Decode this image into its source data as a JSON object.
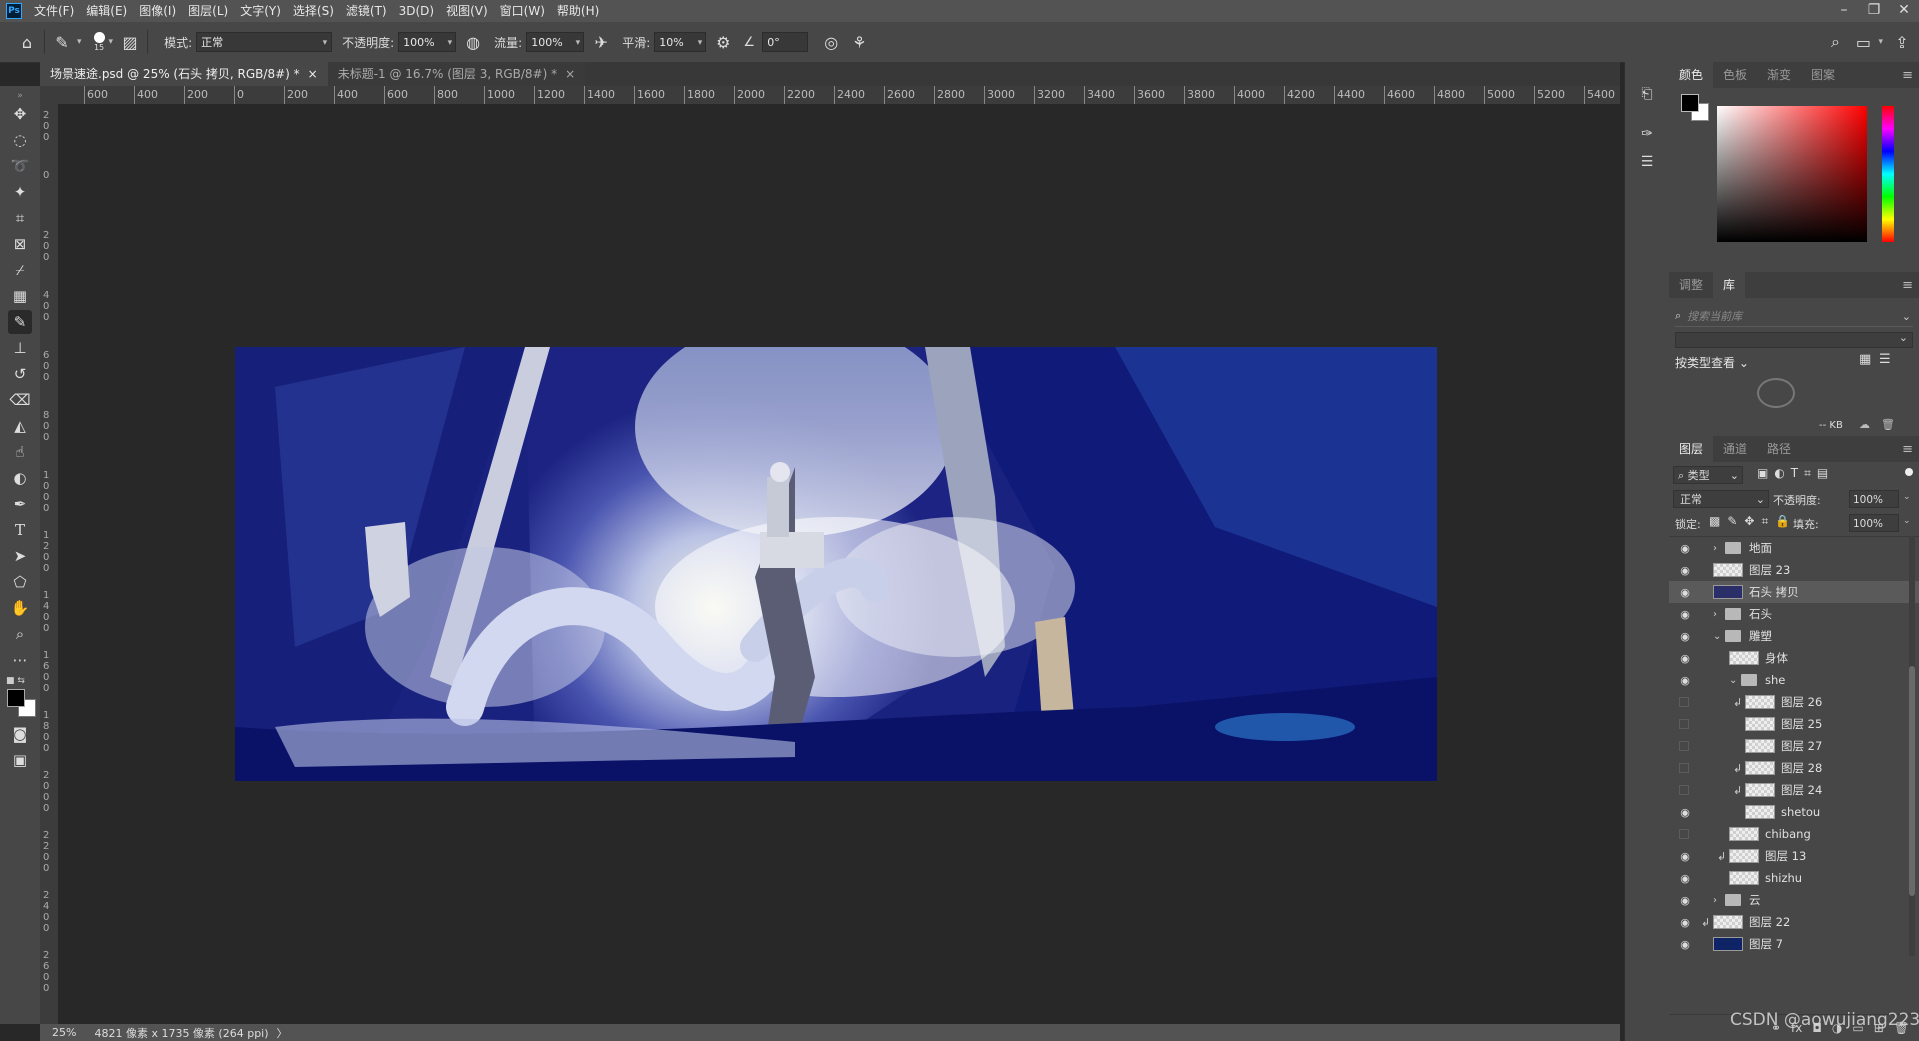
{
  "app": {
    "logo": "Ps"
  },
  "menu": [
    "文件(F)",
    "编辑(E)",
    "图像(I)",
    "图层(L)",
    "文字(Y)",
    "选择(S)",
    "滤镜(T)",
    "3D(D)",
    "视图(V)",
    "窗口(W)",
    "帮助(H)"
  ],
  "options": {
    "brush_size": "15",
    "mode_label": "模式:",
    "mode_value": "正常",
    "opacity_label": "不透明度:",
    "opacity_value": "100%",
    "flow_label": "流量:",
    "flow_value": "100%",
    "smooth_label": "平滑:",
    "smooth_value": "10%",
    "angle_value": "0°"
  },
  "tabs": [
    {
      "label": "场景速途.psd @ 25% (石头 拷贝, RGB/8#) *",
      "close": "×"
    },
    {
      "label": "未标题-1 @ 16.7% (图层 3, RGB/8#) *",
      "close": "×"
    }
  ],
  "ruler_h": [
    "600",
    "400",
    "200",
    "0",
    "200",
    "400",
    "600",
    "800",
    "1000",
    "1200",
    "1400",
    "1600",
    "1800",
    "2000",
    "2200",
    "2400",
    "2600",
    "2800",
    "3000",
    "3200",
    "3400",
    "3600",
    "3800",
    "4000",
    "4200",
    "4400",
    "4600",
    "4800",
    "5000",
    "5200",
    "5400"
  ],
  "ruler_v": [
    "200",
    "0",
    "200",
    "400",
    "600",
    "800",
    "1000",
    "1200",
    "1400",
    "1600",
    "1800",
    "2000",
    "2200",
    "2400",
    "2600"
  ],
  "status": {
    "zoom": "25%",
    "doc_info": "4821 像素 x 1735 像素 (264 ppi)",
    "arrow": "〉"
  },
  "color_panel": {
    "tabs": [
      "颜色",
      "色板",
      "渐变",
      "图案"
    ]
  },
  "adjust_panel": {
    "tabs": [
      "调整",
      "库"
    ],
    "search_placeholder": "搜索当前库",
    "view_label": "按类型查看",
    "kb_label": "-- KB"
  },
  "layers_panel": {
    "tabs": [
      "图层",
      "通道",
      "路径"
    ],
    "filter_label": "类型",
    "blend_mode": "正常",
    "opacity_label": "不透明度:",
    "opacity_value": "100%",
    "lock_label": "锁定:",
    "fill_label": "填充:",
    "fill_value": "100%",
    "layers": [
      {
        "name": "地面",
        "visible": true,
        "type": "folder",
        "collapsed": true,
        "indent": 0
      },
      {
        "name": "图层 23",
        "visible": true,
        "type": "layer",
        "indent": 0
      },
      {
        "name": "石头 拷贝",
        "visible": true,
        "type": "layer",
        "indent": 0,
        "selected": true
      },
      {
        "name": "石头",
        "visible": true,
        "type": "folder",
        "collapsed": true,
        "indent": 0
      },
      {
        "name": "雕塑",
        "visible": true,
        "type": "folder",
        "collapsed": false,
        "indent": 0
      },
      {
        "name": "身体",
        "visible": true,
        "type": "layer",
        "indent": 1
      },
      {
        "name": "she",
        "visible": true,
        "type": "folder",
        "collapsed": false,
        "indent": 1
      },
      {
        "name": "图层 26",
        "visible": false,
        "type": "layer",
        "indent": 2,
        "clip": true
      },
      {
        "name": "图层 25",
        "visible": false,
        "type": "layer",
        "indent": 2
      },
      {
        "name": "图层 27",
        "visible": false,
        "type": "layer",
        "indent": 2
      },
      {
        "name": "图层 28",
        "visible": false,
        "type": "layer",
        "indent": 2,
        "clip": true
      },
      {
        "name": "图层 24",
        "visible": false,
        "type": "layer",
        "indent": 2,
        "clip": true
      },
      {
        "name": "shetou",
        "visible": true,
        "type": "layer",
        "indent": 2
      },
      {
        "name": "chibang",
        "visible": false,
        "type": "layer",
        "indent": 1
      },
      {
        "name": "图层 13",
        "visible": true,
        "type": "layer",
        "indent": 1,
        "clip": true
      },
      {
        "name": "shizhu",
        "visible": true,
        "type": "layer",
        "indent": 1
      },
      {
        "name": "云",
        "visible": true,
        "type": "folder",
        "collapsed": true,
        "indent": 0
      },
      {
        "name": "图层 22",
        "visible": true,
        "type": "layer",
        "indent": 0,
        "clip": true
      },
      {
        "name": "图层 7",
        "visible": true,
        "type": "layer",
        "indent": 0
      }
    ]
  },
  "watermark": "CSDN @aowujiang223"
}
